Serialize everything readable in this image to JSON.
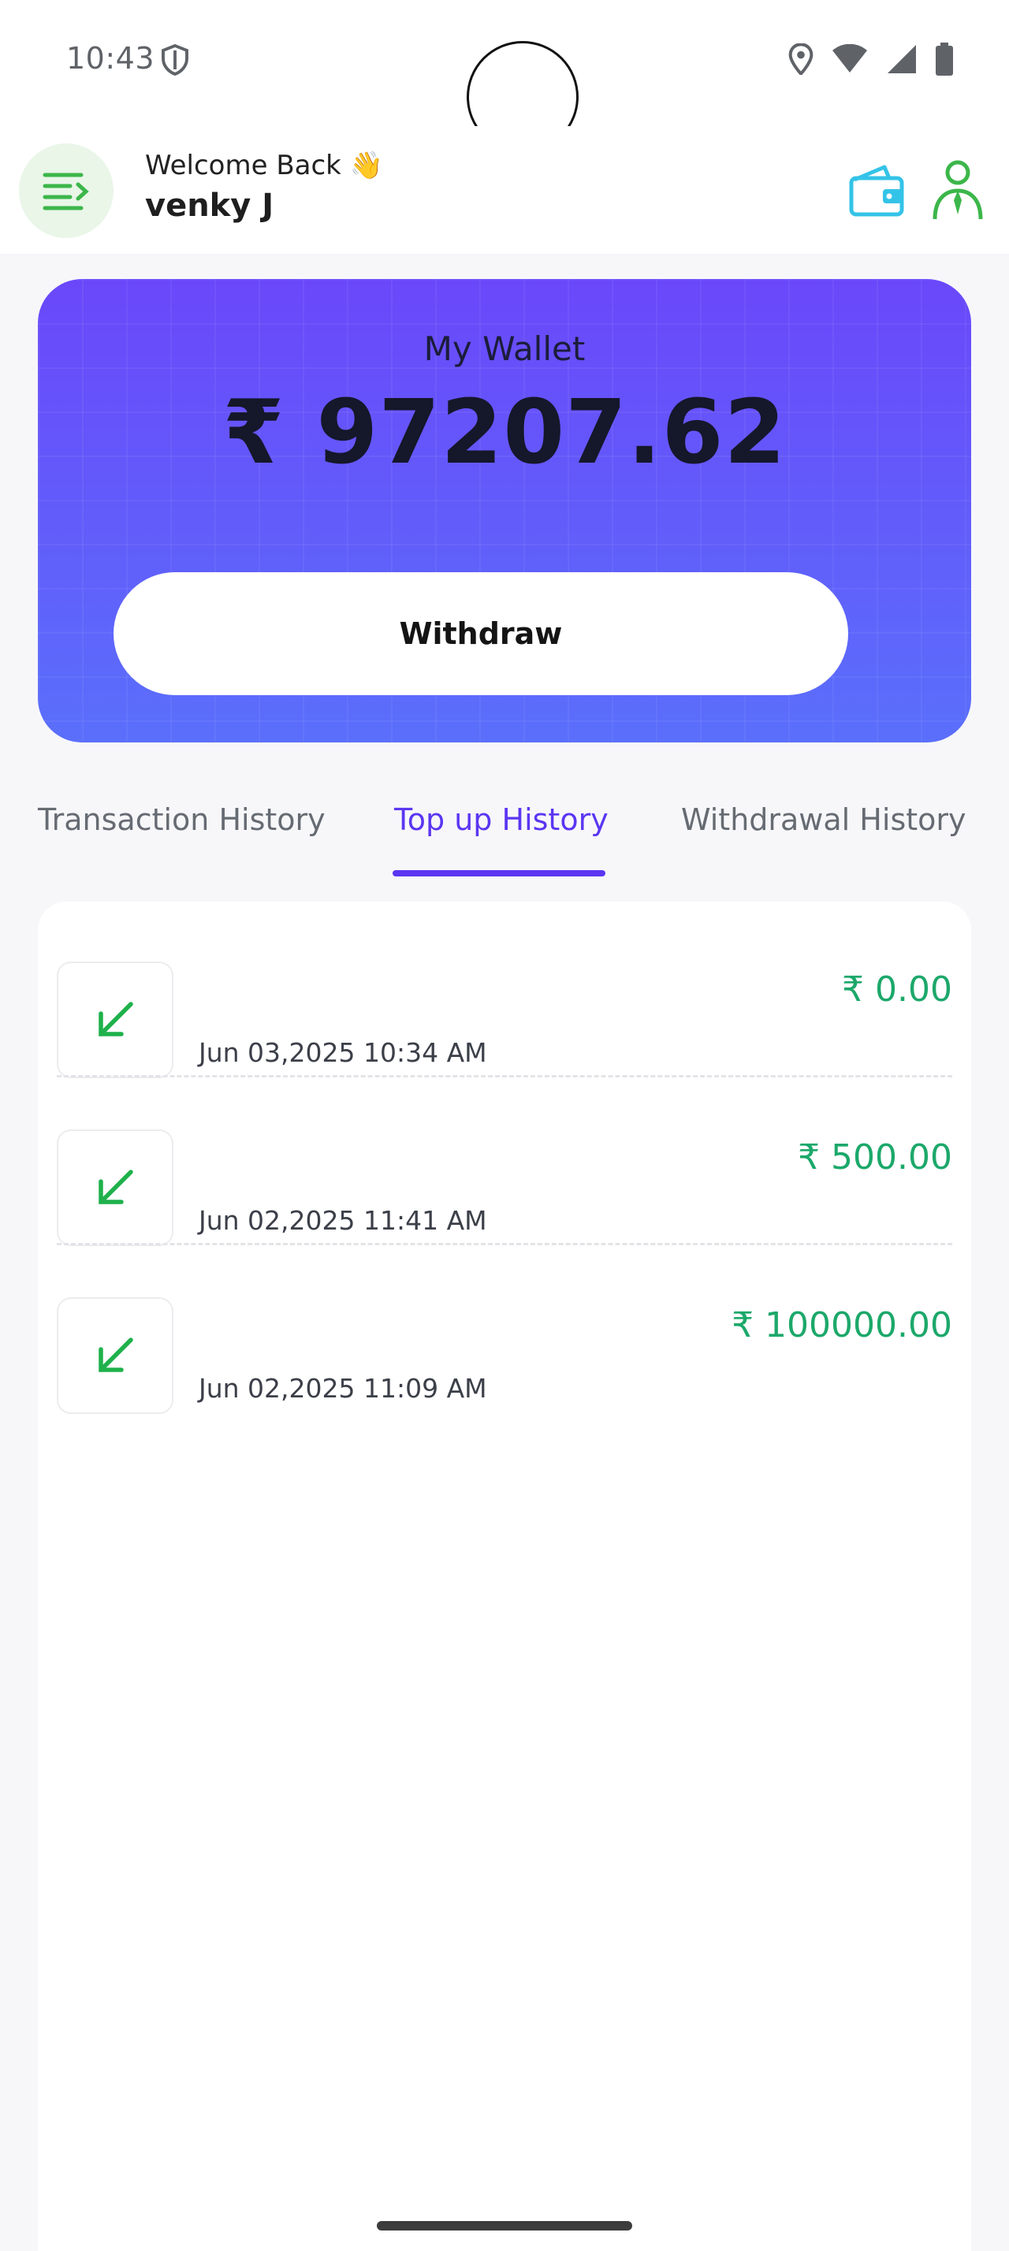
{
  "status_bar": {
    "time": "10:43",
    "icons": [
      "shield-icon",
      "location-icon",
      "wifi-icon",
      "signal-icon",
      "battery-icon"
    ]
  },
  "header": {
    "welcome_text": "Welcome Back 👋",
    "username": "venky J",
    "icons": [
      "menu-icon",
      "wallet-icon",
      "person-icon"
    ]
  },
  "wallet": {
    "title": "My Wallet",
    "amount": "₹ 97207.62",
    "withdraw_label": "Withdraw"
  },
  "tabs": [
    {
      "label": "Transaction History",
      "active": false
    },
    {
      "label": "Top up History",
      "active": true
    },
    {
      "label": "Withdrawal History",
      "active": false
    }
  ],
  "transactions": [
    {
      "date": "Jun 03,2025 10:34 AM",
      "amount": "₹ 0.00",
      "icon": "arrow-down-left-icon"
    },
    {
      "date": "Jun 02,2025 11:41 AM",
      "amount": "₹ 500.00",
      "icon": "arrow-down-left-icon"
    },
    {
      "date": "Jun 02,2025 11:09 AM",
      "amount": "₹ 100000.00",
      "icon": "arrow-down-left-icon"
    }
  ],
  "colors": {
    "accent": "#5b36f2",
    "card_top": "#6a48fa",
    "card_bottom": "#5a6ffb",
    "credit_green": "#1ca86a",
    "menu_green": "#3cb64a",
    "wallet_cyan": "#34c3e8"
  }
}
